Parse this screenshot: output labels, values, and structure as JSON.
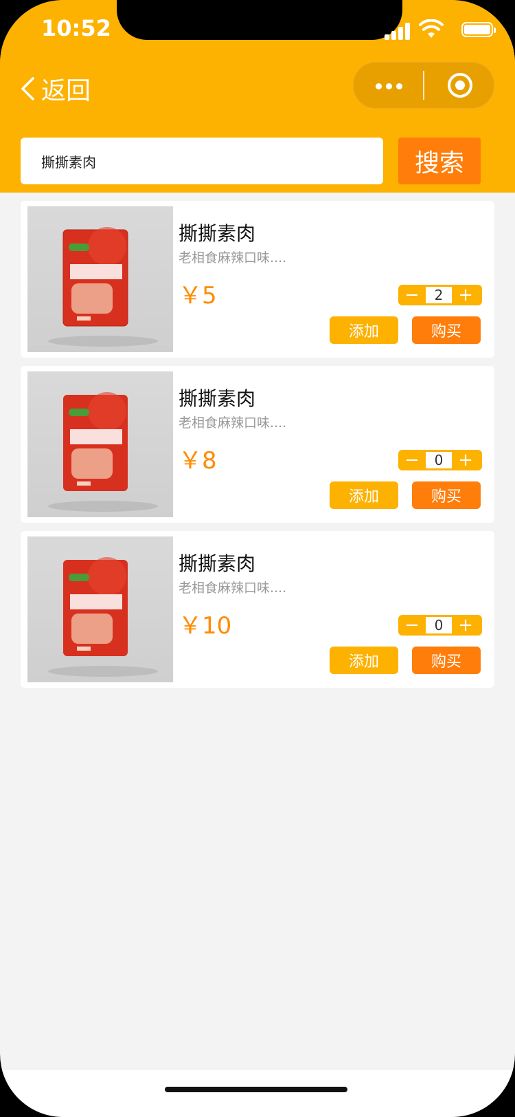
{
  "status_bar": {
    "time": "10:52"
  },
  "nav": {
    "back_label": "返回"
  },
  "search": {
    "value": "撕撕素肉",
    "button_label": "搜索"
  },
  "products": [
    {
      "title": "撕撕素肉",
      "desc": "老相食麻辣口味....",
      "price": "￥5",
      "qty": "2",
      "add_label": "添加",
      "buy_label": "购买",
      "minus": "−",
      "plus": "+"
    },
    {
      "title": "撕撕素肉",
      "desc": "老相食麻辣口味....",
      "price": "￥8",
      "qty": "0",
      "add_label": "添加",
      "buy_label": "购买",
      "minus": "−",
      "plus": "+"
    },
    {
      "title": "撕撕素肉",
      "desc": "老相食麻辣口味....",
      "price": "￥10",
      "qty": "0",
      "add_label": "添加",
      "buy_label": "购买",
      "minus": "−",
      "plus": "+"
    }
  ],
  "colors": {
    "header": "#fdb100",
    "accent_orange": "#ff7d0a",
    "price": "#ff8c00",
    "background": "#f3f3f3"
  }
}
